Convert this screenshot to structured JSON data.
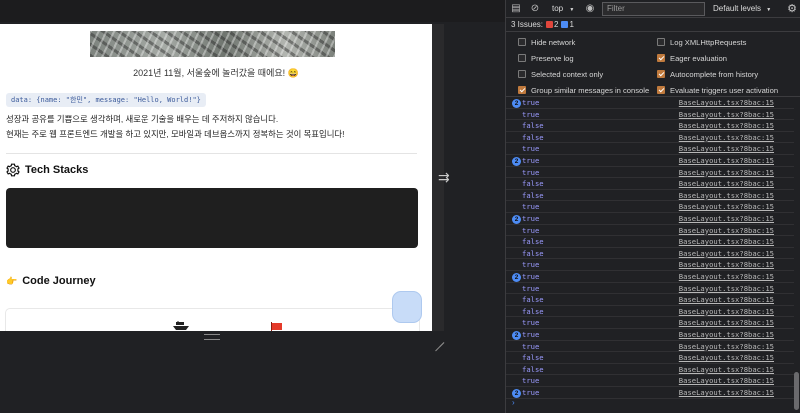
{
  "page": {
    "caption": "2021년 11월, 서울숲에 놀러갔을 때에요! 😄",
    "code_snippet": "data: {name: \"한민\", message: \"Hello, World!\"}",
    "paragraph_1": "성장과 공유를 기쁨으로 생각하며, 새로운 기술을 배우는 데 주저하지 않습니다.",
    "paragraph_2": "현재는 주로 웹 프론트엔드 개발을 하고 있지만, 모바일과 데브옵스까지 정복하는 것이 목표입니다!",
    "tech_stacks_title": "Tech Stacks",
    "code_journey_title": "Code Journey",
    "code_journey_emoji": "👉"
  },
  "devtools": {
    "toolbar": {
      "context": "top",
      "filter_placeholder": "Filter",
      "levels": "Default levels",
      "levels_caret": "▼",
      "context_caret": "▼"
    },
    "issues": {
      "label": "3 Issues:",
      "errors": "2",
      "info": "1"
    },
    "settings": {
      "left": [
        {
          "label": "Hide network",
          "checked": false
        },
        {
          "label": "Preserve log",
          "checked": false
        },
        {
          "label": "Selected context only",
          "checked": false
        },
        {
          "label": "Group similar messages in console",
          "checked": true
        }
      ],
      "right": [
        {
          "label": "Log XMLHttpRequests",
          "checked": false
        },
        {
          "label": "Eager evaluation",
          "checked": true
        },
        {
          "label": "Autocomplete from history",
          "checked": true
        },
        {
          "label": "Evaluate triggers user activation",
          "checked": true
        }
      ]
    },
    "log_source": "BaseLayout.tsx?8bac:15",
    "log_rows": [
      {
        "count": "2",
        "value": "true"
      },
      {
        "count": "",
        "value": "true"
      },
      {
        "count": "",
        "value": "false"
      },
      {
        "count": "",
        "value": "false"
      },
      {
        "count": "",
        "value": "true"
      },
      {
        "count": "2",
        "value": "true"
      },
      {
        "count": "",
        "value": "true"
      },
      {
        "count": "",
        "value": "false"
      },
      {
        "count": "",
        "value": "false"
      },
      {
        "count": "",
        "value": "true"
      },
      {
        "count": "2",
        "value": "true"
      },
      {
        "count": "",
        "value": "true"
      },
      {
        "count": "",
        "value": "false"
      },
      {
        "count": "",
        "value": "false"
      },
      {
        "count": "",
        "value": "true"
      },
      {
        "count": "2",
        "value": "true"
      },
      {
        "count": "",
        "value": "true"
      },
      {
        "count": "",
        "value": "false"
      },
      {
        "count": "",
        "value": "false"
      },
      {
        "count": "",
        "value": "true"
      },
      {
        "count": "2",
        "value": "true"
      },
      {
        "count": "",
        "value": "true"
      },
      {
        "count": "",
        "value": "false"
      },
      {
        "count": "",
        "value": "false"
      },
      {
        "count": "",
        "value": "true"
      },
      {
        "count": "2",
        "value": "true"
      }
    ],
    "prompt_symbol": "›"
  },
  "colors": {
    "console_bg": "#202124",
    "boolean_value": "#9b9bff",
    "accent_checkbox": "#c07a3d",
    "count_badge": "#4d8cf5"
  }
}
